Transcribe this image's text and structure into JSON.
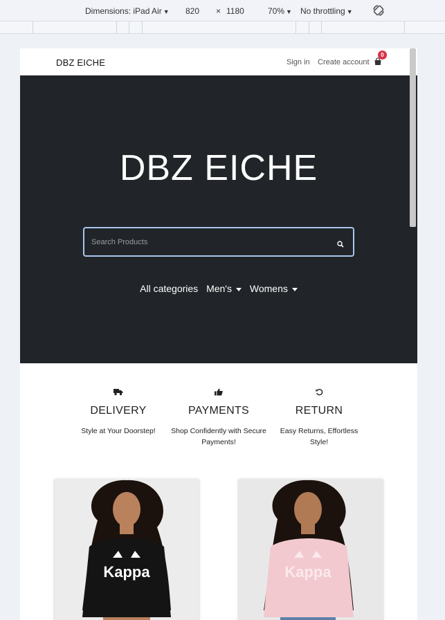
{
  "devtools": {
    "dimensions_label": "Dimensions: iPad Air",
    "width": "820",
    "times": "×",
    "height": "1180",
    "zoom": "70%",
    "throttle": "No throttling"
  },
  "nav": {
    "brand": "DBZ EICHE",
    "sign_in": "Sign in",
    "create_account": "Create account",
    "cart_count": "0"
  },
  "hero": {
    "title": "DBZ EICHE",
    "search_placeholder": "Search Products",
    "categories": [
      {
        "label": "All categories",
        "dropdown": false
      },
      {
        "label": "Men's",
        "dropdown": true
      },
      {
        "label": "Womens",
        "dropdown": true
      }
    ]
  },
  "features": [
    {
      "icon": "truck-icon",
      "title": "DELIVERY",
      "desc": "Style at Your Doorstep!"
    },
    {
      "icon": "thumbs-up-icon",
      "title": "PAYMENTS",
      "desc": "Shop Confidently with Secure Payments!"
    },
    {
      "icon": "undo-icon",
      "title": "RETURN",
      "desc": "Easy Returns, Effortless Style!"
    }
  ],
  "products": [
    {
      "hoodie_text": "Kappa",
      "hoodie_color": "#141414"
    },
    {
      "hoodie_text": "Kappa",
      "hoodie_color": "#f2c9cf"
    }
  ],
  "colors": {
    "hero_bg": "#212529",
    "badge": "#d63447",
    "search_border": "#a9c6f0"
  }
}
